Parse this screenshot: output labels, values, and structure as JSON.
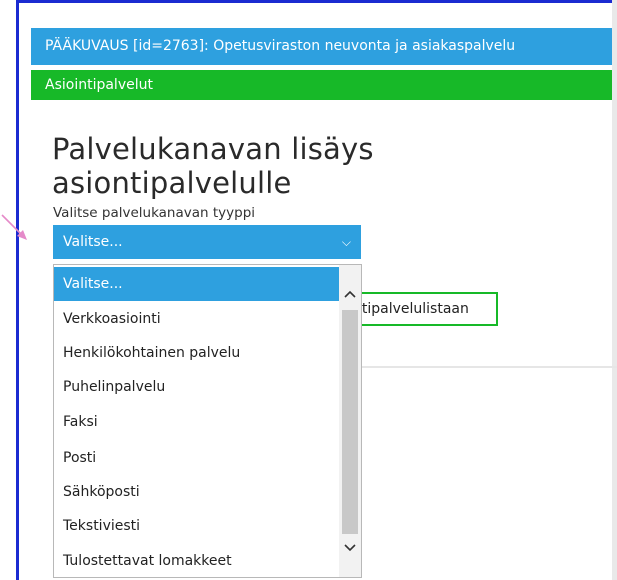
{
  "header": {
    "title": "PÄÄKUVAUS  [id=2763]: Opetusviraston neuvonta ja asiakaspalvelu",
    "subtitle": "Asiointipalvelut"
  },
  "main": {
    "title": "Palvelukanavan lisäys asiontipalvelulle",
    "field_label": "Valitse palvelukanavan tyyppi",
    "select_value": "Valitse...",
    "back_button_label": "ntipalvelulistaan"
  },
  "dropdown": {
    "options": [
      "Valitse...",
      "Verkkoasiointi",
      "Henkilökohtainen palvelu",
      "Puhelinpalvelu",
      "Faksi",
      "Posti",
      "Sähköposti",
      "Tekstiviesti",
      "Tulostettavat lomakkeet"
    ],
    "selected_index": 0
  },
  "colors": {
    "header_blue": "#2ea0df",
    "header_green": "#17b928",
    "frame_blue": "#1b2bd1",
    "annotation_pink": "#e58ac9"
  },
  "icons": {
    "select_chevron": "chevron-down-icon",
    "scroll_up": "scroll-up-icon",
    "scroll_down": "scroll-down-icon",
    "annotation": "annotation-arrow-icon"
  }
}
